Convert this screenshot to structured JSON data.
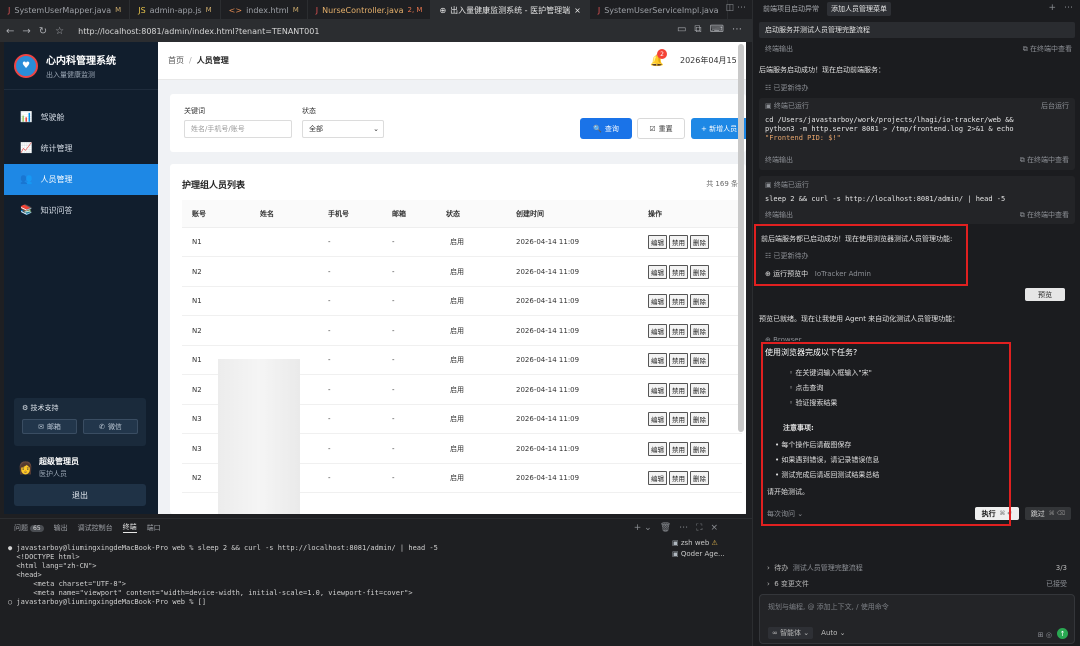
{
  "editor_tabs": [
    {
      "icon": "J",
      "name": "SystemUserMapper.java",
      "mod": "M"
    },
    {
      "icon": "JS",
      "name": "admin-app.js",
      "mod": "M"
    },
    {
      "icon": "<>",
      "name": "index.html",
      "mod": "M"
    },
    {
      "icon": "J",
      "name": "NurseController.java",
      "mod": "2, M"
    },
    {
      "icon": "⊕",
      "name": "出入量健康监测系统 - 医护管理端",
      "mod": ""
    },
    {
      "icon": "J",
      "name": "SystemUserServiceImpl.java",
      "mod": ""
    }
  ],
  "browser": {
    "url": "http://localhost:8081/admin/index.html?tenant=TENANT001"
  },
  "app": {
    "title": "心内科管理系统",
    "subtitle": "出入量健康监测",
    "menu": [
      {
        "icon": "📊",
        "label": "驾驶舱"
      },
      {
        "icon": "📈",
        "label": "统计管理"
      },
      {
        "icon": "👥",
        "label": "人员管理"
      },
      {
        "icon": "📚",
        "label": "知识问答"
      }
    ],
    "support_title": "技术支持",
    "support_email": "邮箱",
    "support_wechat": "微信",
    "user_name": "超级管理员",
    "user_role": "医护人员",
    "logout": "退出"
  },
  "topbar": {
    "home": "首页",
    "sep": "/",
    "current": "人员管理",
    "badge": "2",
    "date": "2026年04月15日"
  },
  "filter": {
    "keyword_label": "关键词",
    "keyword_placeholder": "姓名/手机号/账号",
    "status_label": "状态",
    "status_value": "全部",
    "query": "查询",
    "reset": "重置",
    "add": "+ 新增人员"
  },
  "table": {
    "title": "护理组人员列表",
    "total": "共 169 条",
    "headers": [
      "账号",
      "姓名",
      "手机号",
      "邮箱",
      "状态",
      "创建时间",
      "操作"
    ],
    "rows": [
      {
        "account": "N1",
        "phone": "-",
        "email": "-",
        "status": "启用",
        "created": "2026-04-14 11:09"
      },
      {
        "account": "N2",
        "phone": "-",
        "email": "-",
        "status": "启用",
        "created": "2026-04-14 11:09"
      },
      {
        "account": "N1",
        "phone": "-",
        "email": "-",
        "status": "启用",
        "created": "2026-04-14 11:09"
      },
      {
        "account": "N2",
        "phone": "-",
        "email": "-",
        "status": "启用",
        "created": "2026-04-14 11:09"
      },
      {
        "account": "N1",
        "phone": "-",
        "email": "-",
        "status": "启用",
        "created": "2026-04-14 11:09"
      },
      {
        "account": "N2",
        "phone": "-",
        "email": "-",
        "status": "启用",
        "created": "2026-04-14 11:09"
      },
      {
        "account": "N3",
        "phone": "-",
        "email": "-",
        "status": "启用",
        "created": "2026-04-14 11:09"
      },
      {
        "account": "N3",
        "phone": "-",
        "email": "-",
        "status": "启用",
        "created": "2026-04-14 11:09"
      },
      {
        "account": "N2",
        "phone": "-",
        "email": "-",
        "status": "启用",
        "created": "2026-04-14 11:09"
      }
    ],
    "op_edit": "编辑",
    "op_disable": "禁用",
    "op_delete": "删除"
  },
  "terminal": {
    "tabs": [
      {
        "label": "问题",
        "count": "65"
      },
      {
        "label": "输出",
        "count": ""
      },
      {
        "label": "调试控制台",
        "count": ""
      },
      {
        "label": "终端",
        "count": ""
      },
      {
        "label": "端口",
        "count": ""
      }
    ],
    "lines": [
      "● javastarboy@liumingxingdeMacBook-Pro web % sleep 2 && curl -s http://localhost:8081/admin/ | head -5",
      "  <!DOCTYPE html>",
      "  <html lang=\"zh-CN\">",
      "  <head>",
      "      <meta charset=\"UTF-8\">",
      "      <meta name=\"viewport\" content=\"width=device-width, initial-scale=1.0, viewport-fit=cover\">",
      "○ javastarboy@liumingxingdeMacBook-Pro web % []"
    ],
    "sessions": [
      "zsh web",
      "Qoder Age..."
    ]
  },
  "chat": {
    "tabs": [
      "前端项目启动异常",
      "添加人员管理菜单"
    ],
    "title": "启动服务并测试人员管理完整流程",
    "term_output": "终端输出",
    "open_in_terminal": "在终端中查看",
    "msg1": "后端服务启动成功！现在启动前端服务：",
    "auto_run": "已更新待办",
    "term_ran": "终端已运行",
    "bg_run": "后台运行",
    "cmd1_a": "cd /Users/javastarboy/work/projects/lhagi/io-tracker/web &&",
    "cmd1_b": "python3 -m http.server 8081 > /tmp/frontend.log 2>&1 & echo",
    "cmd1_c": "\"Frontend PID: $!\"",
    "cmd2": "sleep 2 && curl -s http://localhost:8081/admin/ | head -5",
    "msg2": "前后端服务都已启动成功！现在使用浏览器测试人员管理功能:",
    "preview_running": "运行预览中",
    "preview_app": "IoTracker Admin",
    "preview_btn": "预览",
    "msg3": "预览已就绪。现在让我使用 Agent 来自动化测试人员管理功能：",
    "browser_label": "Browser",
    "dialog_q": "使用浏览器完成以下任务?",
    "steps": [
      "在关键词输入框输入\"宋\"",
      "点击查询",
      "验证搜索结果"
    ],
    "notice": "注意事项:",
    "bullets": [
      "每个操作后请截图保存",
      "如果遇到错误，请记录错误信息",
      "测试完成后请返回测试结果总结"
    ],
    "start": "请开始测试。",
    "always_ask": "每次询问",
    "exec": "执行",
    "exec_kbd": "⌘ ↵",
    "skip": "跳过",
    "skip_kbd": "⌘ ⌫",
    "todo_label": "待办",
    "todo_text": "测试人员管理完整流程",
    "todo_count": "3/3",
    "changes": "6 变更文件",
    "accepted": "已接受",
    "input_placeholder": "规划与编程, @ 添加上下文, / 使用命令",
    "model": "智能体",
    "auto": "Auto"
  }
}
